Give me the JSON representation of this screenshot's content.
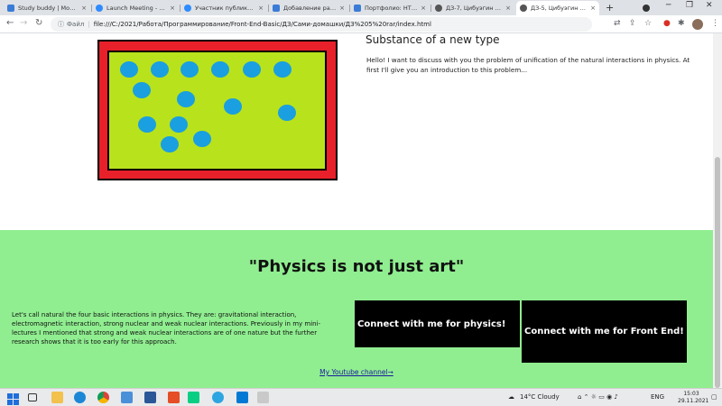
{
  "browser": {
    "tabs": [
      {
        "label": "Study buddy | Moocl...",
        "color": "#3b7cd6"
      },
      {
        "label": "Launch Meeting - Zo...",
        "color": "#2d8cff"
      },
      {
        "label": "Участник публикации...",
        "color": "#2d8cff"
      },
      {
        "label": "Добавление работы...",
        "color": "#3b7cd6"
      },
      {
        "label": "Портфолио: HTML-р...",
        "color": "#3b7cd6"
      },
      {
        "label": "ДЗ-7, Цибуэгин В., 21...",
        "color": "#555555"
      },
      {
        "label": "ДЗ-5, Цибуэгин В., 14...",
        "color": "#555555"
      }
    ],
    "tab_close_glyph": "×",
    "new_tab_glyph": "+",
    "address": {
      "info_glyph": "ⓘ",
      "scheme_label": "Файл",
      "separator": "|",
      "url": "file:///C:/2021/Работа/Программирование/Front-End-Basic/ДЗ/Сами-домашки/ДЗ%205%20rar/index.html"
    }
  },
  "page": {
    "article_title": "Substance of a new type",
    "article_text": "Hello! I want to discuss with you the problem of unification of the natural interactions in physics. At first I'll give you an introduction to this problem...",
    "quote": "\"Physics is not just art\"",
    "body_text": "Let's call natural the four basic interactions in physics. They are: gravitational interaction, electromagnetic interaction, strong nuclear and weak nuclear interactions. Previously in my mini-lectures I mentioned that strong and weak nuclear interactions are of one nature but the further research shows that it is too early for this approach.",
    "cta_physics": "Connect with me for physics!",
    "cta_front": "Connect with me for Front End!",
    "youtube_link": "My Youtube channel→",
    "colors": {
      "frame": "#e8202a",
      "field": "#b8e21c",
      "dots": "#1a9fe0",
      "section_bg": "#90ee90",
      "cta_bg": "#000000"
    }
  },
  "taskbar": {
    "weather": "14°C  Cloudy",
    "language": "ENG",
    "time": "15:03",
    "date": "29.11.2021"
  }
}
